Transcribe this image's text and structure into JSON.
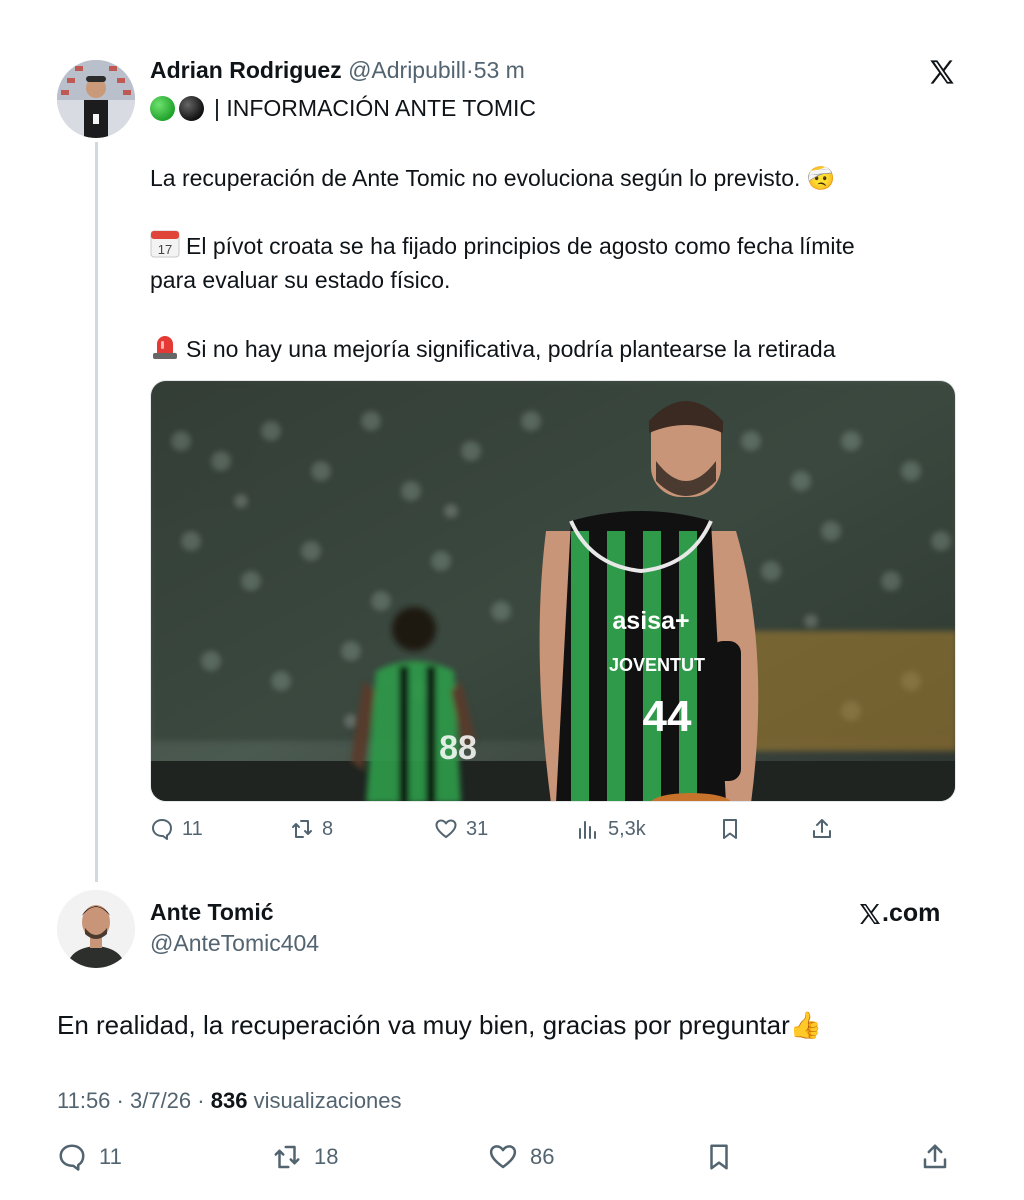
{
  "original_tweet": {
    "author_name": "Adrian Rodriguez",
    "handle": "@Adripubill",
    "separator": "·",
    "time": "53 m",
    "headline": "| INFORMACIÓN ANTE TOMIC",
    "paragraph1": "La recuperación de Ante Tomic no evoluciona según lo previsto. 🤕",
    "calendar_emoji_day": "17",
    "paragraph2_line1": "El pívot croata se ha fijado principios de agosto como fecha límite",
    "paragraph2_line2": "para evaluar su estado físico.",
    "paragraph3": "Si no hay una mejoría significativa, podría plantearse la retirada",
    "image": {
      "jersey_sponsor": "asisa+",
      "jersey_team": "JOVENTUT",
      "jersey_number_main": "44",
      "jersey_number_back": "88"
    },
    "actions": {
      "replies": "11",
      "reposts": "8",
      "likes": "31",
      "views": "5,3k"
    }
  },
  "reply_tweet": {
    "author_name": "Ante Tomić",
    "handle": "@AnteTomic404",
    "brand": ".com",
    "text": "En realidad, la recuperación va muy bien, gracias por preguntar👍",
    "time": "11:56",
    "date": "3/7/26",
    "views_count": "836",
    "views_label": "visualizaciones",
    "actions": {
      "replies": "11",
      "reposts": "18",
      "likes": "86"
    }
  },
  "colors": {
    "text": "#0f1419",
    "muted": "#536471",
    "thread_line": "#cfd9de",
    "jersey_green": "#2f9a4a"
  }
}
